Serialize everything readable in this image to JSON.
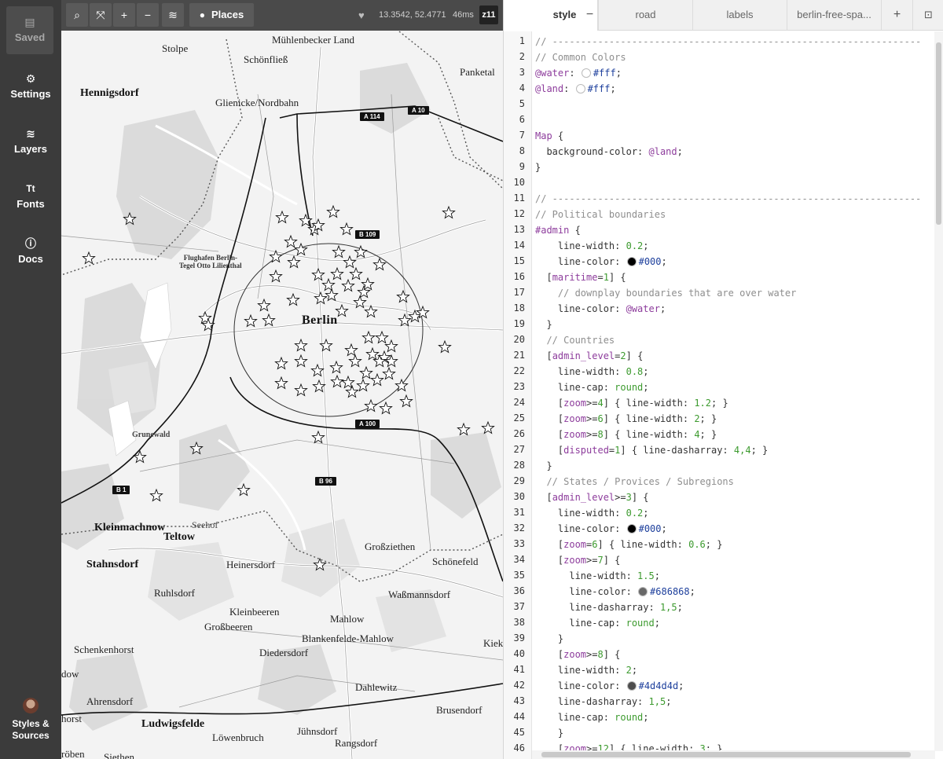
{
  "sidebar": {
    "items": [
      {
        "label": "Saved",
        "icon": "save-icon"
      },
      {
        "label": "Settings",
        "icon": "gear-icon"
      },
      {
        "label": "Layers",
        "icon": "layers-icon"
      },
      {
        "label": "Fonts",
        "icon": "font-icon"
      },
      {
        "label": "Docs",
        "icon": "info-icon"
      }
    ],
    "bottom": {
      "label_line1": "Styles &",
      "label_line2": "Sources",
      "icon": "avatar"
    }
  },
  "map_toolbar": {
    "buttons": [
      {
        "icon": "search-icon",
        "glyph": "⌕"
      },
      {
        "icon": "fullscreen-icon",
        "glyph": "⤧"
      },
      {
        "icon": "zoom-in-icon",
        "glyph": "+"
      },
      {
        "icon": "zoom-out-icon",
        "glyph": "−"
      },
      {
        "icon": "inspect-layers-icon",
        "glyph": "≋"
      }
    ],
    "places_label": "Places",
    "coordinates": "13.3542, 52.4771",
    "render_time": "46ms",
    "zoom": "z11"
  },
  "map": {
    "places": [
      {
        "name": "Mühlenbecker Land",
        "size": "md"
      },
      {
        "name": "Stolpe",
        "size": "md"
      },
      {
        "name": "Schönfließ",
        "size": "md"
      },
      {
        "name": "Panketal",
        "size": "md"
      },
      {
        "name": "Hennigsdorf",
        "size": "lg"
      },
      {
        "name": "Glienicke/Nordbahn",
        "size": "md"
      },
      {
        "name": "Berlin",
        "size": "city"
      },
      {
        "name": "Grunewald",
        "size": "sm"
      },
      {
        "name": "Kleinmachnow",
        "size": "lg"
      },
      {
        "name": "Seehof",
        "size": "sm"
      },
      {
        "name": "Teltow",
        "size": "lg"
      },
      {
        "name": "Stahnsdorf",
        "size": "lg"
      },
      {
        "name": "Heinersdorf",
        "size": "md"
      },
      {
        "name": "Großziethen",
        "size": "md"
      },
      {
        "name": "Schönefeld",
        "size": "md"
      },
      {
        "name": "Ruhlsdorf",
        "size": "md"
      },
      {
        "name": "Waßmannsdorf",
        "size": "md"
      },
      {
        "name": "Kleinbeeren",
        "size": "md"
      },
      {
        "name": "Mahlow",
        "size": "md"
      },
      {
        "name": "Großbeeren",
        "size": "md"
      },
      {
        "name": "Blankenfelde-Mahlow",
        "size": "md"
      },
      {
        "name": "Schenkenhorst",
        "size": "md"
      },
      {
        "name": "Diedersdorf",
        "size": "md"
      },
      {
        "name": "Kieko",
        "size": "md"
      },
      {
        "name": "dow",
        "size": "md"
      },
      {
        "name": "Dahlewitz",
        "size": "md"
      },
      {
        "name": "Ahrensdorf",
        "size": "md"
      },
      {
        "name": "Brusendorf",
        "size": "md"
      },
      {
        "name": "horst",
        "size": "md"
      },
      {
        "name": "Ludwigsfelde",
        "size": "lg"
      },
      {
        "name": "Jühnsdorf",
        "size": "md"
      },
      {
        "name": "Löwenbruch",
        "size": "md"
      },
      {
        "name": "Rangsdorf",
        "size": "md"
      },
      {
        "name": "röben",
        "size": "md"
      },
      {
        "name": "Siethen",
        "size": "md"
      }
    ],
    "airport": {
      "line1": "Flughafen Berlin-",
      "line2": "Tegel Otto Lilienthal"
    },
    "shields": [
      "A 114",
      "A 10",
      "B 109",
      "A 100",
      "B 96",
      "B 1"
    ]
  },
  "editor": {
    "tabs": [
      "style",
      "road",
      "labels",
      "berlin-free-spa..."
    ],
    "active_tab": "style",
    "tab_controls": {
      "remove": "−",
      "add": "+",
      "collapse": "⊡"
    },
    "line_numbers": [
      "1",
      "2",
      "3",
      "4",
      "5",
      "6",
      "7",
      "8",
      "9",
      "10",
      "11",
      "12",
      "13",
      "14",
      "15",
      "16",
      "17",
      "18",
      "19",
      "20",
      "21",
      "22",
      "23",
      "24",
      "25",
      "26",
      "27",
      "28",
      "29",
      "30",
      "31",
      "32",
      "33",
      "34",
      "35",
      "36",
      "37",
      "38",
      "39",
      "40",
      "41",
      "42",
      "43",
      "44",
      "45",
      "46"
    ],
    "colors": {
      "water": "#fff",
      "land": "#fff",
      "black": "#000",
      "grey": "#686868",
      "dark": "#4d4d4d"
    },
    "code_lines": [
      "// -----------------------------------------------------------------",
      "// Common Colors",
      "@water: #fff;",
      "@land: #fff;",
      "",
      "",
      "Map {",
      "  background-color: @land;",
      "}",
      "",
      "// -----------------------------------------------------------------",
      "// Political boundaries",
      "#admin {",
      "    line-width: 0.2;",
      "    line-color: #000;",
      "  [maritime=1] {",
      "    // downplay boundaries that are over water",
      "    line-color: @water;",
      "  }",
      "  // Countries",
      "  [admin_level=2] {",
      "    line-width: 0.8;",
      "    line-cap: round;",
      "    [zoom>=4] { line-width: 1.2; }",
      "    [zoom>=6] { line-width: 2; }",
      "    [zoom>=8] { line-width: 4; }",
      "    [disputed=1] { line-dasharray: 4,4; }",
      "  }",
      "  // States / Provices / Subregions",
      "  [admin_level>=3] {",
      "    line-width: 0.2;",
      "    line-color: #000;",
      "    [zoom=6] { line-width: 0.6; }",
      "    [zoom>=7] {",
      "      line-width: 1.5;",
      "      line-color: #686868;",
      "      line-dasharray: 1,5;",
      "      line-cap: round;",
      "    }",
      "    [zoom>=8] {",
      "    line-width: 2;",
      "    line-color: #4d4d4d;",
      "    line-dasharray: 1,5;",
      "    line-cap: round;",
      "    }",
      "    [zoom>=12] { line-width: 3; }"
    ]
  }
}
